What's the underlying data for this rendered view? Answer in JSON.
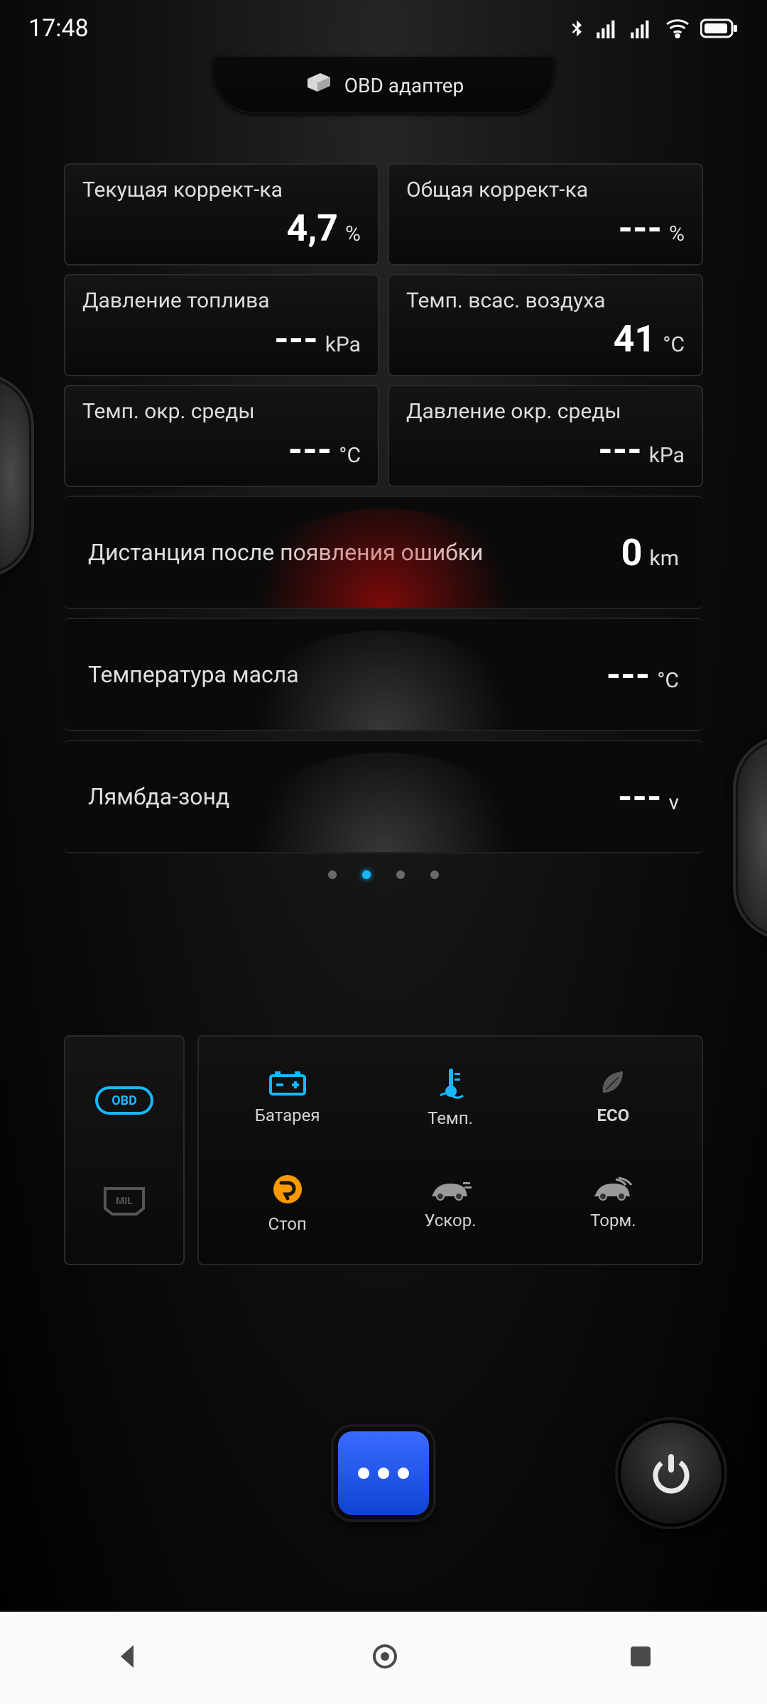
{
  "status": {
    "time": "17:48"
  },
  "header": {
    "title": "OBD адаптер"
  },
  "cards": [
    {
      "label": "Текущая коррект-ка",
      "value": "4,7",
      "unit": "%"
    },
    {
      "label": "Общая коррект-ка",
      "value": "---",
      "unit": "%"
    },
    {
      "label": "Давление топлива",
      "value": "---",
      "unit": "kPa"
    },
    {
      "label": "Темп. всас. воздуха",
      "value": "41",
      "unit": "°C"
    },
    {
      "label": "Темп. окр. среды",
      "value": "---",
      "unit": "°C"
    },
    {
      "label": "Давление окр. среды",
      "value": "---",
      "unit": "kPa"
    }
  ],
  "fullcards": [
    {
      "label": "Дистанция после появления ошибки",
      "value": "0",
      "unit": "km",
      "color": "red"
    },
    {
      "label": "Температура масла",
      "value": "---",
      "unit": "°C",
      "color": "grey"
    },
    {
      "label": "Лямбда-зонд",
      "value": "---",
      "unit": "v",
      "color": "grey"
    }
  ],
  "page_dots": {
    "total": 4,
    "active": 1
  },
  "tiles": [
    {
      "label": "Батарея"
    },
    {
      "label": "Темп."
    },
    {
      "label": "ECO"
    },
    {
      "label": "Стоп"
    },
    {
      "label": "Ускор."
    },
    {
      "label": "Торм."
    }
  ]
}
